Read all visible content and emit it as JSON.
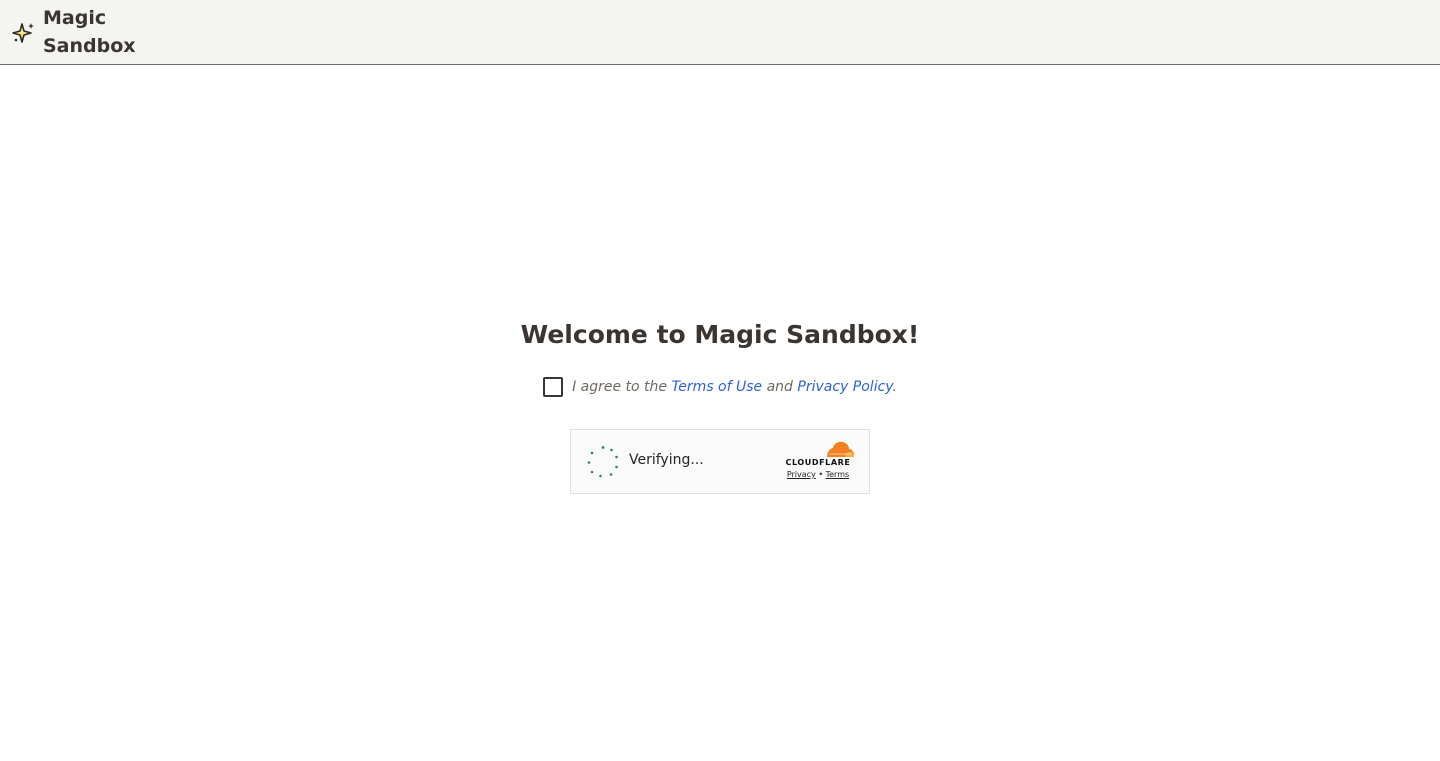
{
  "header": {
    "brand_line1": "Magic",
    "brand_line2": "Sandbox",
    "brand_icon": "sparkle-icon"
  },
  "main": {
    "title": "Welcome to Magic Sandbox!",
    "agree": {
      "prefix": "I agree to the ",
      "terms_label": "Terms of Use",
      "middle": " and ",
      "privacy_label": "Privacy Policy",
      "suffix": ".",
      "checked": false
    }
  },
  "captcha": {
    "status": "Verifying...",
    "provider": "CLOUDFLARE",
    "privacy_label": "Privacy",
    "separator": "•",
    "terms_label": "Terms",
    "spinner_icon": "spinner-icon",
    "logo_icon": "cloudflare-cloud-icon",
    "colors": {
      "spinner": "#1e8f4e",
      "cloud_orange": "#f38020",
      "cloud_light": "#faae40"
    }
  },
  "colors": {
    "link": "#2a62d8",
    "header_bg": "#f4f4f2",
    "text": "#3a3530"
  }
}
